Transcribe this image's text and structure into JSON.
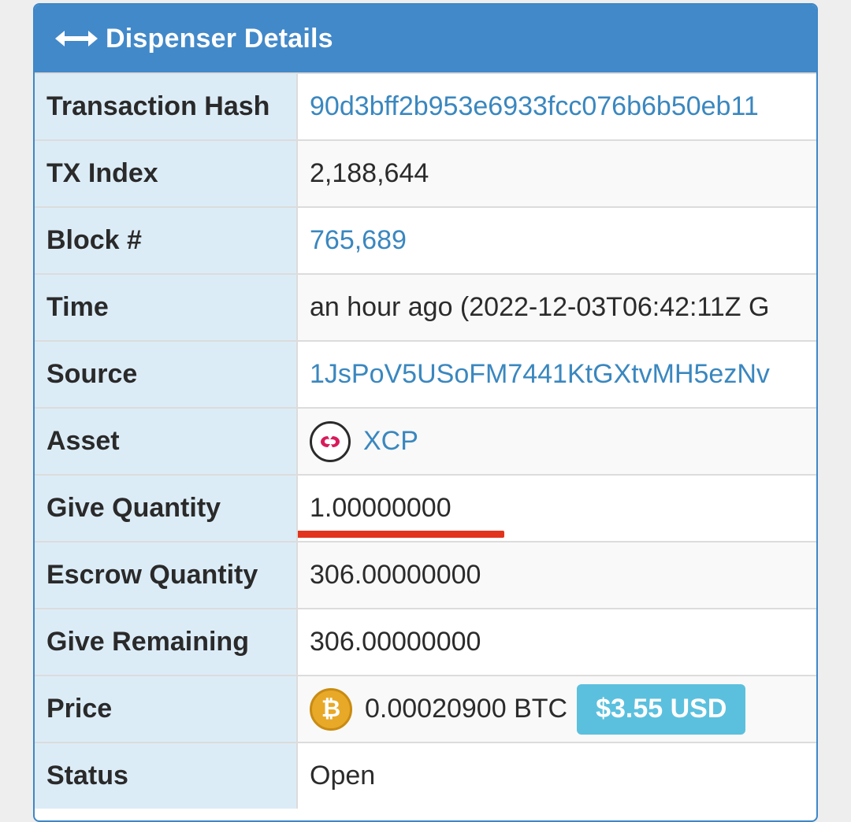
{
  "panel": {
    "title": "Dispenser Details",
    "header_icon": "left-right-arrow-icon",
    "header_color": "#4289c9"
  },
  "rows": [
    {
      "label": "Transaction Hash",
      "value": "90d3bff2b953e6933fcc076b6b50eb11"
    },
    {
      "label": "TX Index",
      "value": "2,188,644"
    },
    {
      "label": "Block #",
      "value": "765,689"
    },
    {
      "label": "Time",
      "value": "an hour ago (2022-12-03T06:42:11Z G"
    },
    {
      "label": "Source",
      "value": "1JsPoV5USoFM7441KtGXtvMH5ezNv"
    },
    {
      "label": "Asset",
      "value": "XCP",
      "icon": "xcp-logo-icon"
    },
    {
      "label": "Give Quantity",
      "value": "1.00000000"
    },
    {
      "label": "Escrow Quantity",
      "value": "306.00000000"
    },
    {
      "label": "Give Remaining",
      "value": "306.00000000"
    },
    {
      "label": "Price",
      "value": "0.00020900 BTC",
      "icon": "bitcoin-icon",
      "badge": "$3.55 USD"
    },
    {
      "label": "Status",
      "value": "Open"
    }
  ],
  "colors": {
    "link": "#3a87bf",
    "label_bg": "#dcecf7",
    "badge": "#5bc0de",
    "annotation": "#e2341d"
  }
}
